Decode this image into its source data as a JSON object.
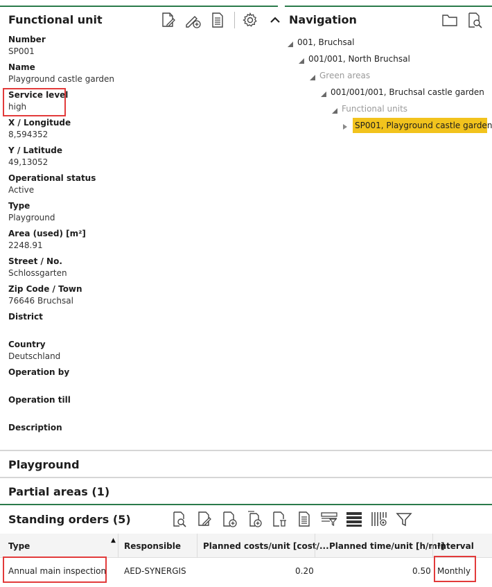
{
  "functional_unit": {
    "title": "Functional unit",
    "toolbar_icons": [
      "edit-document-icon",
      "edit-add-icon",
      "report-icon",
      "settings-gear-icon",
      "collapse-chevron-up-icon"
    ],
    "fields": [
      {
        "label": "Number",
        "value": "SP001"
      },
      {
        "label": "Name",
        "value": "Playground castle garden"
      },
      {
        "label": "Service level",
        "value": "high"
      },
      {
        "label": "X / Longitude",
        "value": "8,594352"
      },
      {
        "label": "Y / Latitude",
        "value": "49,13052"
      },
      {
        "label": "Operational status",
        "value": "Active"
      },
      {
        "label": "Type",
        "value": "Playground"
      },
      {
        "label": "Area (used) [m²]",
        "value": "2248.91"
      },
      {
        "label": "Street / No.",
        "value": "Schlossgarten"
      },
      {
        "label": "Zip Code / Town",
        "value": "76646 Bruchsal"
      },
      {
        "label": "District",
        "value": ""
      },
      {
        "label": "Country",
        "value": "Deutschland"
      },
      {
        "label": "Operation by",
        "value": ""
      },
      {
        "label": "Operation till",
        "value": ""
      },
      {
        "label": "Description",
        "value": ""
      }
    ]
  },
  "navigation": {
    "title": "Navigation",
    "toolbar_icons": [
      "folder-icon",
      "document-search-icon"
    ],
    "tree": [
      {
        "label": "001, Bruchsal",
        "muted": false,
        "expanded": true
      },
      {
        "label": "001/001, North Bruchsal",
        "muted": false,
        "expanded": true
      },
      {
        "label": "Green areas",
        "muted": true,
        "expanded": true
      },
      {
        "label": "001/001/001, Bruchsal castle garden",
        "muted": false,
        "expanded": true
      },
      {
        "label": "Functional units",
        "muted": true,
        "expanded": true
      },
      {
        "label": "SP001, Playground castle garden",
        "muted": false,
        "expanded": false,
        "selected": true
      }
    ]
  },
  "sections": {
    "playground": "Playground",
    "partial_areas": "Partial areas (1)",
    "standing_orders": "Standing orders (5)"
  },
  "standing_orders_toolbar": [
    "search-document-icon",
    "edit-document-icon",
    "add-document-icon",
    "add-document-copy-icon",
    "delete-document-icon",
    "report-icon",
    "filter-row-icon",
    "list-view-icon",
    "column-settings-icon",
    "filter-funnel-icon"
  ],
  "grid": {
    "columns": [
      "Type",
      "Responsible",
      "Planned costs/unit [cost/...",
      "Planned time/unit [h/m²]",
      "Interval"
    ],
    "rows": [
      {
        "type": "Annual main inspection",
        "responsible": "AED-SYNERGIS",
        "costs": "0.20",
        "time": "0.50",
        "interval": "Monthly"
      }
    ]
  },
  "colors": {
    "accent_green": "#2a7a4a",
    "selection_yellow": "#f2c31d",
    "highlight_red": "#e23a3a"
  }
}
